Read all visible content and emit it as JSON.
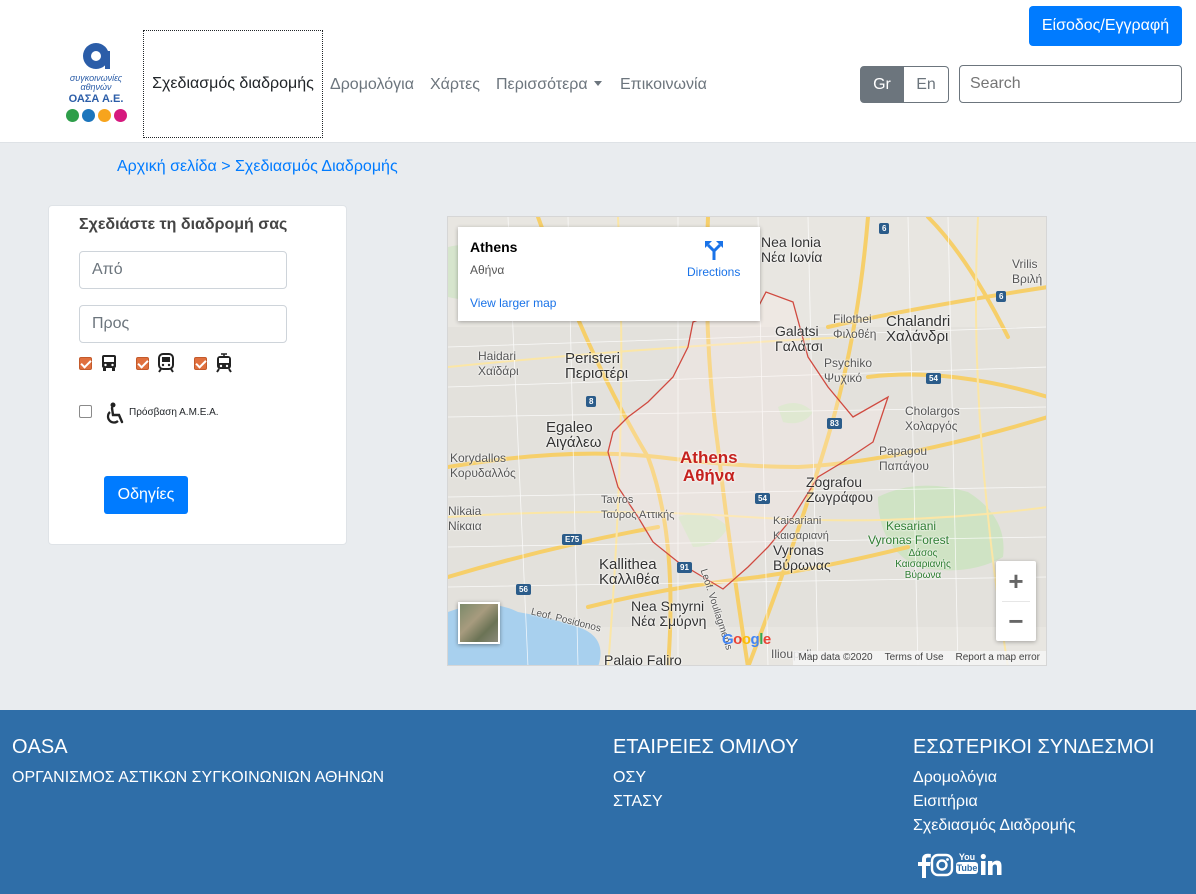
{
  "header": {
    "logo": {
      "line1": "συγκοινωνίες",
      "line2": "αθηνών",
      "line3": "ΟΑΣΑ Α.Ε.",
      "dot_colors": [
        "#2e9e4a",
        "#1c75bc",
        "#f7a41d",
        "#d6197e"
      ]
    },
    "nav": [
      {
        "label": "Σχεδιασμός διαδρομής",
        "active": true
      },
      {
        "label": "Δρομολόγια"
      },
      {
        "label": "Χάρτες"
      },
      {
        "label": "Περισσότερα",
        "dropdown": true
      },
      {
        "label": "Επικοινωνία"
      }
    ],
    "lang": {
      "gr": "Gr",
      "en": "En",
      "selected": "Gr"
    },
    "search_placeholder": "Search",
    "login_label": "Είσοδος/Εγγραφή"
  },
  "breadcrumb": "Αρχική σελίδα > Σχεδιασμός Διαδρομής",
  "route_panel": {
    "title": "Σχεδιάστε τη διαδρομή σας",
    "from_placeholder": "Από",
    "to_placeholder": "Προς",
    "modes": [
      {
        "icon": "bus-icon",
        "checked": true
      },
      {
        "icon": "metro-icon",
        "checked": true
      },
      {
        "icon": "tram-icon",
        "checked": true
      }
    ],
    "accessibility": {
      "icon": "wheelchair-icon",
      "label": "Πρόσβαση Α.Μ.Ε.Α.",
      "checked": false
    },
    "submit_label": "Οδηγίες"
  },
  "map": {
    "info_card": {
      "title": "Athens",
      "subtitle": "Αθήνα",
      "larger_map": "View larger map",
      "directions": "Directions"
    },
    "city": {
      "en": "Athens",
      "gr": "Αθήνα"
    },
    "places": [
      {
        "en": "Nea Ionia",
        "gr": "Νέα Ιωνία"
      },
      {
        "en": "Galatsi",
        "gr": "Γαλάτσι"
      },
      {
        "en": "Filothei",
        "gr": "Φιλοθέη"
      },
      {
        "en": "Chalandri",
        "gr": "Χαλάνδρι"
      },
      {
        "en": "Psychiko",
        "gr": "Ψυχικό"
      },
      {
        "en": "Haidari",
        "gr": "Χαϊδάρι"
      },
      {
        "en": "Peristeri",
        "gr": "Περιστέρι"
      },
      {
        "en": "Egaleo",
        "gr": "Αιγάλεω"
      },
      {
        "en": "Cholargos",
        "gr": "Χολαργός"
      },
      {
        "en": "Papagou",
        "gr": "Παπάγου"
      },
      {
        "en": "Korydallos",
        "gr": "Κορυδαλλός"
      },
      {
        "en": "Zografou",
        "gr": "Ζωγράφου"
      },
      {
        "en": "Nikaia",
        "gr": "Νίκαια"
      },
      {
        "en": "Tavros",
        "gr": "Ταύρος Αττικής"
      },
      {
        "en": "Kaisariani",
        "gr": "Καισαριανή"
      },
      {
        "en": "Vyronas",
        "gr": "Βύρωνας"
      },
      {
        "en": "Kallithea",
        "gr": "Καλλιθέα"
      },
      {
        "en": "Nea Smyrni",
        "gr": "Νέα Σμύρνη"
      },
      {
        "en": "Palaio Faliro",
        "gr": ""
      },
      {
        "en": "Ilioupoli",
        "gr": ""
      },
      {
        "en": "Vrilis",
        "gr": "Βριλή"
      }
    ],
    "green_labels": [
      "Kesariani",
      "Vyronas Forest",
      "Δάσος Καισαριανής Βύρωνα"
    ],
    "road_labels": [
      "Leof. Posidonos",
      "Leof. Vouliagmenis"
    ],
    "shields": [
      "6",
      "6",
      "8",
      "83",
      "54",
      "54",
      "E75",
      "91",
      "56"
    ],
    "attribution": {
      "data": "Map data ©2020",
      "terms": "Terms of Use",
      "report": "Report a map error"
    },
    "google": "Google",
    "zoom_in": "+",
    "zoom_out": "−"
  },
  "footer": {
    "col1": {
      "heading": "OASA",
      "items": [
        "ΟΡΓΑΝΙΣΜΟΣ ΑΣΤΙΚΩΝ ΣΥΓΚΟΙΝΩΝΙΩΝ ΑΘΗΝΩΝ"
      ]
    },
    "col2": {
      "heading": "ΕΤΑΙΡΕΙΕΣ ΟΜΙΛΟΥ",
      "items": [
        "ΟΣΥ",
        "ΣΤΑΣΥ"
      ]
    },
    "col3": {
      "heading": "ΕΣΩΤΕΡΙΚΟΙ ΣΥΝΔΕΣΜΟΙ",
      "items": [
        "Δρομολόγια",
        "Εισιτήρια",
        "Σχεδιασμός Διαδρομής"
      ]
    },
    "social": [
      "facebook-icon",
      "instagram-icon",
      "youtube-icon",
      "linkedin-icon"
    ],
    "youtube_text": {
      "you": "You",
      "tube": "Tube"
    }
  },
  "colors": {
    "primary": "#007bff",
    "footer_bg": "#2f6ea8",
    "page_bg": "#e9ecef",
    "checkbox_accent": "#e0703e",
    "city_label": "#c5221f"
  }
}
